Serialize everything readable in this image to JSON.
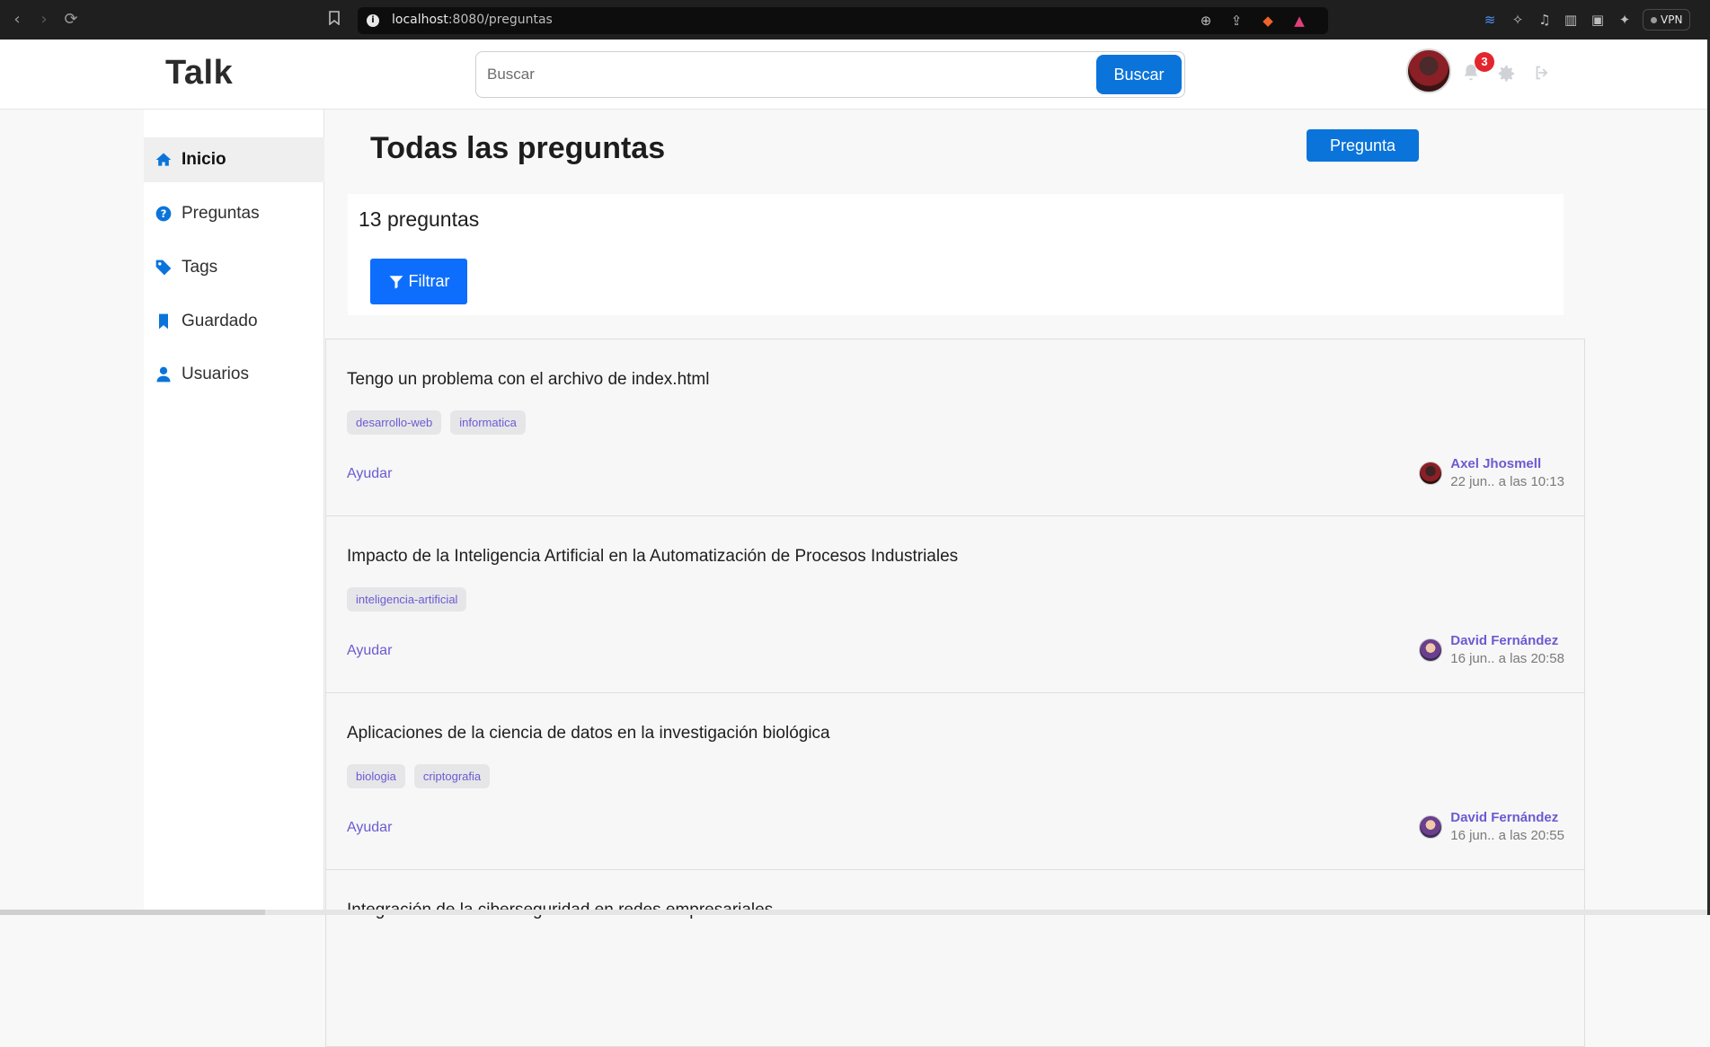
{
  "browser": {
    "url_host": "localhost",
    "url_path": ":8080/preguntas",
    "vpn_label": "VPN"
  },
  "header": {
    "logo": "Talk",
    "search_placeholder": "Buscar",
    "search_button": "Buscar",
    "notification_count": "3"
  },
  "sidebar": {
    "items": [
      {
        "label": "Inicio",
        "icon": "home-icon",
        "active": true
      },
      {
        "label": "Preguntas",
        "icon": "question-circle-icon"
      },
      {
        "label": "Tags",
        "icon": "tag-icon"
      },
      {
        "label": "Guardado",
        "icon": "bookmark-icon"
      },
      {
        "label": "Usuarios",
        "icon": "user-icon"
      }
    ]
  },
  "main": {
    "title": "Todas las preguntas",
    "ask_button": "Pregunta",
    "count_text": "13 preguntas",
    "filter_button": "Filtrar"
  },
  "questions": [
    {
      "title": "Tengo un problema con el archivo de index.html",
      "tags": [
        "desarrollo-web",
        "informatica"
      ],
      "help_label": "Ayudar",
      "author": "Axel Jhosmell",
      "date": "22 jun.. a las 10:13"
    },
    {
      "title": "Impacto de la Inteligencia Artificial en la Automatización de Procesos Industriales",
      "tags": [
        "inteligencia-artificial"
      ],
      "help_label": "Ayudar",
      "author": "David Fernández",
      "date": "16 jun.. a las 20:58"
    },
    {
      "title": "Aplicaciones de la ciencia de datos en la investigación biológica",
      "tags": [
        "biologia",
        "criptografia"
      ],
      "help_label": "Ayudar",
      "author": "David Fernández",
      "date": "16 jun.. a las 20:55"
    },
    {
      "title": "Integración de la ciberseguridad en redes empresariales"
    }
  ],
  "colors": {
    "primary": "#0a74da",
    "accent_purple": "#6b5bd2",
    "badge_red": "#e3262d"
  }
}
